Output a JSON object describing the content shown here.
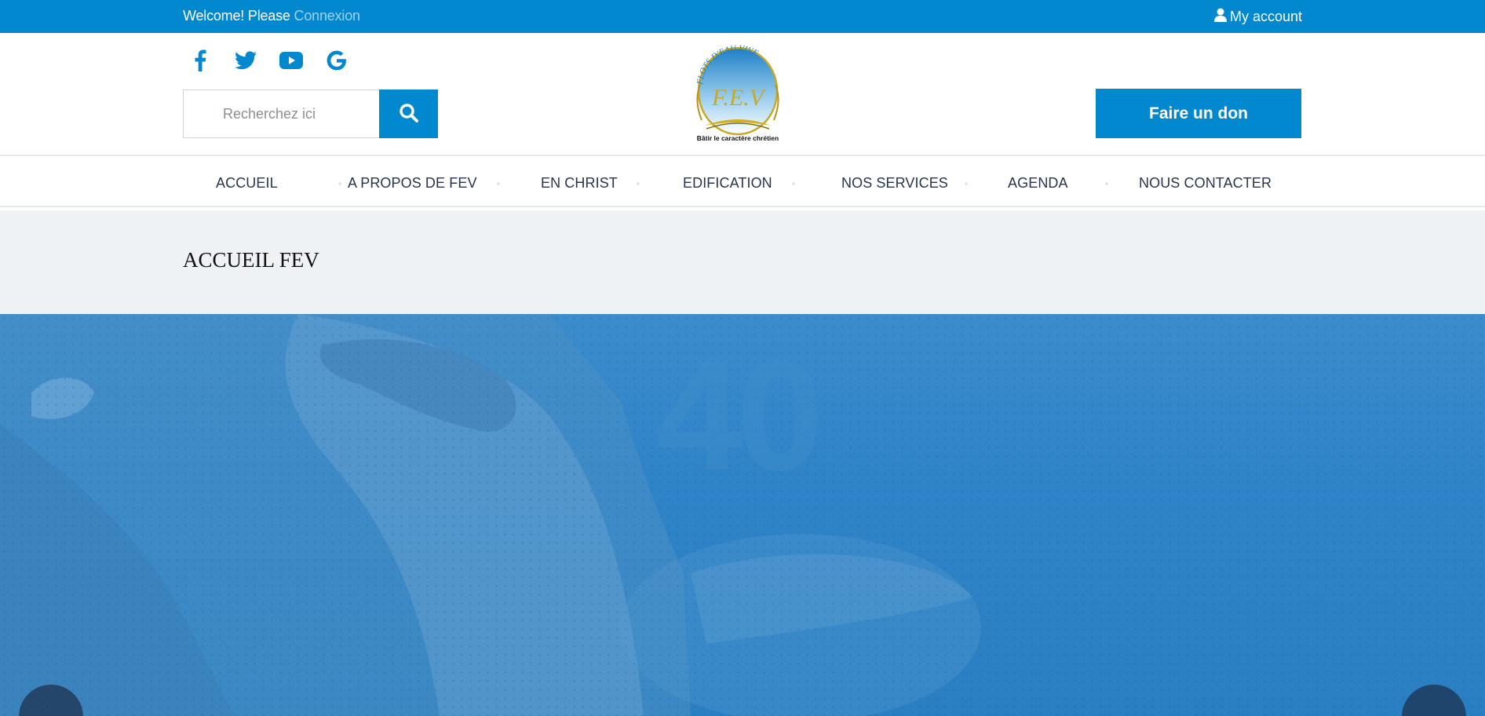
{
  "topbar": {
    "welcome_text": "Welcome! Please",
    "login_link": "Connexion",
    "account_label": "My account",
    "account_icon": "user-icon"
  },
  "header": {
    "socials": [
      {
        "name": "facebook-icon"
      },
      {
        "name": "twitter-icon"
      },
      {
        "name": "youtube-icon"
      },
      {
        "name": "google-icon"
      }
    ],
    "search": {
      "placeholder": "Recherchez ici",
      "value": "",
      "button_icon": "search-icon"
    },
    "logo": {
      "arc_text": "FLOTS D'EAU VIVE",
      "initials": "F.E.V",
      "tagline": "Bâtir le caractère chrétien"
    },
    "donate_label": "Faire un don"
  },
  "nav": {
    "items": [
      {
        "label": "ACCUEIL"
      },
      {
        "label": "A PROPOS DE FEV"
      },
      {
        "label": "EN CHRIST"
      },
      {
        "label": "EDIFICATION"
      },
      {
        "label": "NOS SERVICES"
      },
      {
        "label": "AGENDA"
      },
      {
        "label": "NOUS CONTACTER"
      }
    ]
  },
  "page": {
    "title": "ACCUEIL FEV"
  },
  "hero": {
    "big_number": "40"
  },
  "colors": {
    "primary": "#0288cf",
    "nav_text": "#27364a",
    "strip_bg": "#eef2f5",
    "hero_bg": "#2f84c8"
  }
}
